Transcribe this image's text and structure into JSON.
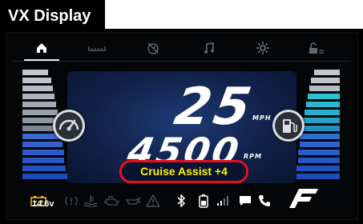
{
  "header": {
    "title": "VX Display"
  },
  "nav": {
    "items": [
      "home-icon",
      "odometer-icon",
      "speedometer-off-icon",
      "music-icon",
      "settings-icon",
      "lock-icon"
    ],
    "active": "home-icon"
  },
  "gauges": {
    "speed": "25",
    "speed_unit": "MPH",
    "rpm": "4500",
    "rpm_unit": "RPM"
  },
  "cruise": {
    "label": "Cruise Assist  +4"
  },
  "status": {
    "voltage": "14.6v",
    "icons": [
      "battery-icon",
      "tire-pressure-icon",
      "coolant-icon",
      "oil-icon",
      "engine-icon",
      "warning-icon",
      "bluetooth-icon",
      "phone-battery-icon",
      "signal-icon",
      "message-icon",
      "phone-icon",
      "brand-logo-icon"
    ]
  },
  "colors": {
    "accent_red": "#e8101c",
    "cruise_text": "#fff200",
    "panel_blue": "#11224a",
    "bar_blue": "#2f63d6",
    "bar_teal": "#27b6cf"
  }
}
